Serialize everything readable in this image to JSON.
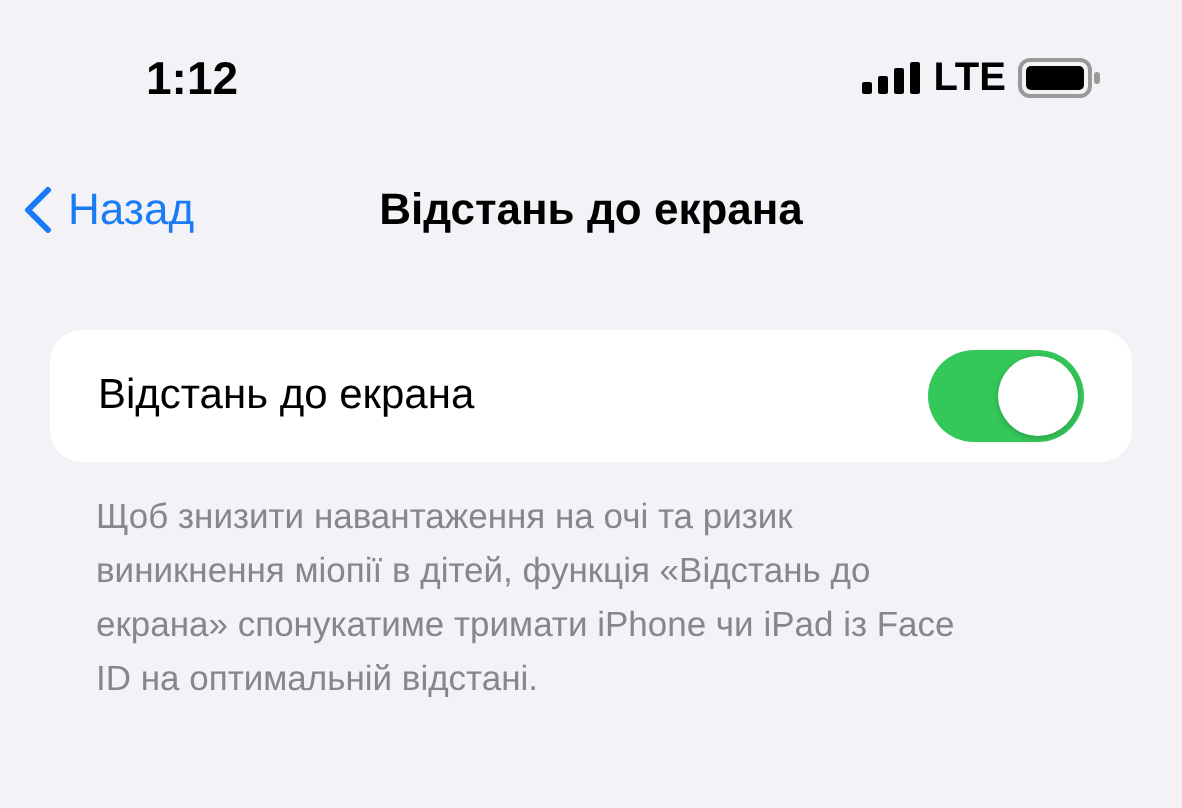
{
  "status_bar": {
    "time": "1:12",
    "network": "LTE"
  },
  "nav": {
    "back": "Назад",
    "title": "Відстань до екрана"
  },
  "setting": {
    "label": "Відстань до екрана",
    "on": true
  },
  "footer": "Щоб знизити навантаження на очі та ризик виникнення міопії в дітей, функція «Відстань до екрана» спонукатиме тримати iPhone чи iPad із Face ID на оптимальній відстані."
}
